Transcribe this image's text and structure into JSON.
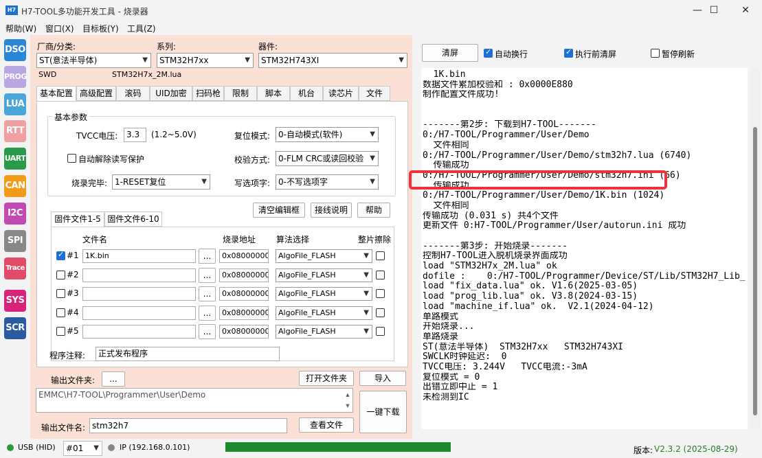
{
  "window": {
    "icon_text": "H7",
    "title": "H7-TOOL多功能开发工具 - 烧录器",
    "minimize": "—",
    "maximize": "☐",
    "close": "✕"
  },
  "menu": [
    "帮助(W)",
    "窗口(X)",
    "目标板(Y)",
    "工具(Z)"
  ],
  "sidebar": [
    {
      "label": "DSO",
      "color": "#2a86d6"
    },
    {
      "label": "PROG",
      "color": "#b8a7e0"
    },
    {
      "label": "LUA",
      "color": "#4aa6d8"
    },
    {
      "label": "RTT",
      "color": "#f0a0a0"
    },
    {
      "label": "UART",
      "color": "#2a9a4a"
    },
    {
      "label": "CAN",
      "color": "#f29a1a"
    },
    {
      "label": "I2C",
      "color": "#c04ab0"
    },
    {
      "label": "SPI",
      "color": "#888888"
    },
    {
      "label": "Trace",
      "color": "#e24a6a"
    },
    {
      "label": "SYS",
      "color": "#d8237a"
    },
    {
      "label": "SCR",
      "color": "#2a5aa0"
    }
  ],
  "device": {
    "vendor_label": "厂商/分类:",
    "vendor_value": "ST(意法半导体)",
    "series_label": "系列:",
    "series_value": "STM32H7xx",
    "part_label": "器件:",
    "part_value": "STM32H743XI",
    "interface": "SWD",
    "lua_file": "STM32H7x_2M.lua"
  },
  "tabs": [
    "基本配置",
    "高级配置",
    "滚码",
    "UID加密",
    "扫码枪",
    "限制",
    "脚本",
    "机台",
    "读芯片",
    "文件"
  ],
  "basic": {
    "group_title": "基本参数",
    "tvcc_label": "TVCC电压:",
    "tvcc_value": "3.3",
    "tvcc_range": "(1.2~5.0V)",
    "reset_label": "复位模式:",
    "reset_value": "0-自动模式(软件)",
    "auto_unlock_label": "自动解除读写保护",
    "verify_label": "校验方式:",
    "verify_value": "0-FLM CRC或读回校验",
    "burn_done_label": "烧录完毕:",
    "burn_done_value": "1-RESET复位",
    "option_label": "写选项字:",
    "option_value": "0-不写选项字",
    "clear_button": "清空编辑框",
    "wiring_button": "接线说明",
    "help_button": "帮助"
  },
  "firmware": {
    "tab1": "固件文件1-5",
    "tab2": "固件文件6-10",
    "col_name": "文件名",
    "col_addr": "烧录地址",
    "col_algo": "算法选择",
    "col_erase": "整片擦除",
    "browse": "...",
    "rows": [
      {
        "id": "#1",
        "checked": true,
        "file": "1K.bin",
        "addr": "0x08000000",
        "algo": "AlgoFile_FLASH"
      },
      {
        "id": "#2",
        "checked": false,
        "file": "",
        "addr": "0x08000000",
        "algo": "AlgoFile_FLASH"
      },
      {
        "id": "#3",
        "checked": false,
        "file": "",
        "addr": "0x08000000",
        "algo": "AlgoFile_FLASH"
      },
      {
        "id": "#4",
        "checked": false,
        "file": "",
        "addr": "0x08000000",
        "algo": "AlgoFile_FLASH"
      },
      {
        "id": "#5",
        "checked": false,
        "file": "",
        "addr": "0x08000000",
        "algo": "AlgoFile_FLASH"
      }
    ]
  },
  "note": {
    "label": "程序注释:",
    "value": "正式发布程序"
  },
  "output": {
    "folder_label": "输出文件夹:",
    "folder_browse": "...",
    "open_folder": "打开文件夹",
    "import": "导入",
    "path": "EMMC\\H7-TOOL\\Programmer\\User\\Demo",
    "download": "一键下载",
    "filename_label": "输出文件名:",
    "filename_value": "stm32h7",
    "view_file": "查看文件"
  },
  "log_toolbar": {
    "clear": "清屏",
    "auto_wrap": "自动换行",
    "clear_before": "执行前清屏",
    "pause": "暂停刷新"
  },
  "log_lines": [
    "  1K.bin",
    "数据文件累加校验和 : 0x0000E880",
    "制作配置文件成功!",
    "",
    "",
    "-------第2步: 下载到H7-TOOL-------",
    "0:/H7-TOOL/Programmer/User/Demo",
    "  文件相同",
    "0:/H7-TOOL/Programmer/User/Demo/stm32h7.lua (6740)",
    "  传输成功",
    "0:/H7-TOOL/Programmer/User/Demo/stm32h7.ini (66)",
    "  传输成功",
    "0:/H7-TOOL/Programmer/User/Demo/1K.bin (1024)",
    "  文件相同",
    "传输成功 (0.031 s) 共4个文件",
    "更新文件 0:H7-TOOL/Programmer/User/autorun.ini 成功",
    "",
    "-------第3步: 开始烧录-------",
    "控制H7-TOOL进入脱机烧录界面成功",
    "load \"STM32H7x_2M.lua\" ok",
    "dofile :    0:/H7-TOOL/Programmer/Device/ST/Lib/STM32H7_Lib_",
    "load \"fix_data.lua\" ok. V1.6(2025-03-05)",
    "load \"prog_lib.lua\" ok. V3.8(2024-03-15)",
    "load \"machine_if.lua\" ok.  V2.1(2024-04-12)",
    "单路模式",
    "开始烧录...",
    "单路烧录",
    "ST(意法半导体)  STM32H7xx   STM32H743XI",
    "SWCLK时钟延迟:  0",
    "TVCC电压: 3.244V   TVCC电流:-3mA",
    "复位模式 = 0",
    "出错立即中止 = 1",
    "未检测到IC"
  ],
  "status": {
    "usb": "USB (HID)",
    "usb_color": "#2a9a3a",
    "port": "#01",
    "ip": "IP (192.168.0.101)",
    "ip_color": "#888888",
    "progress": 1.0,
    "progress_color": "#1e8a2e",
    "version_label": "版本:",
    "version_value": "V2.3.2 (2025-08-29)"
  }
}
